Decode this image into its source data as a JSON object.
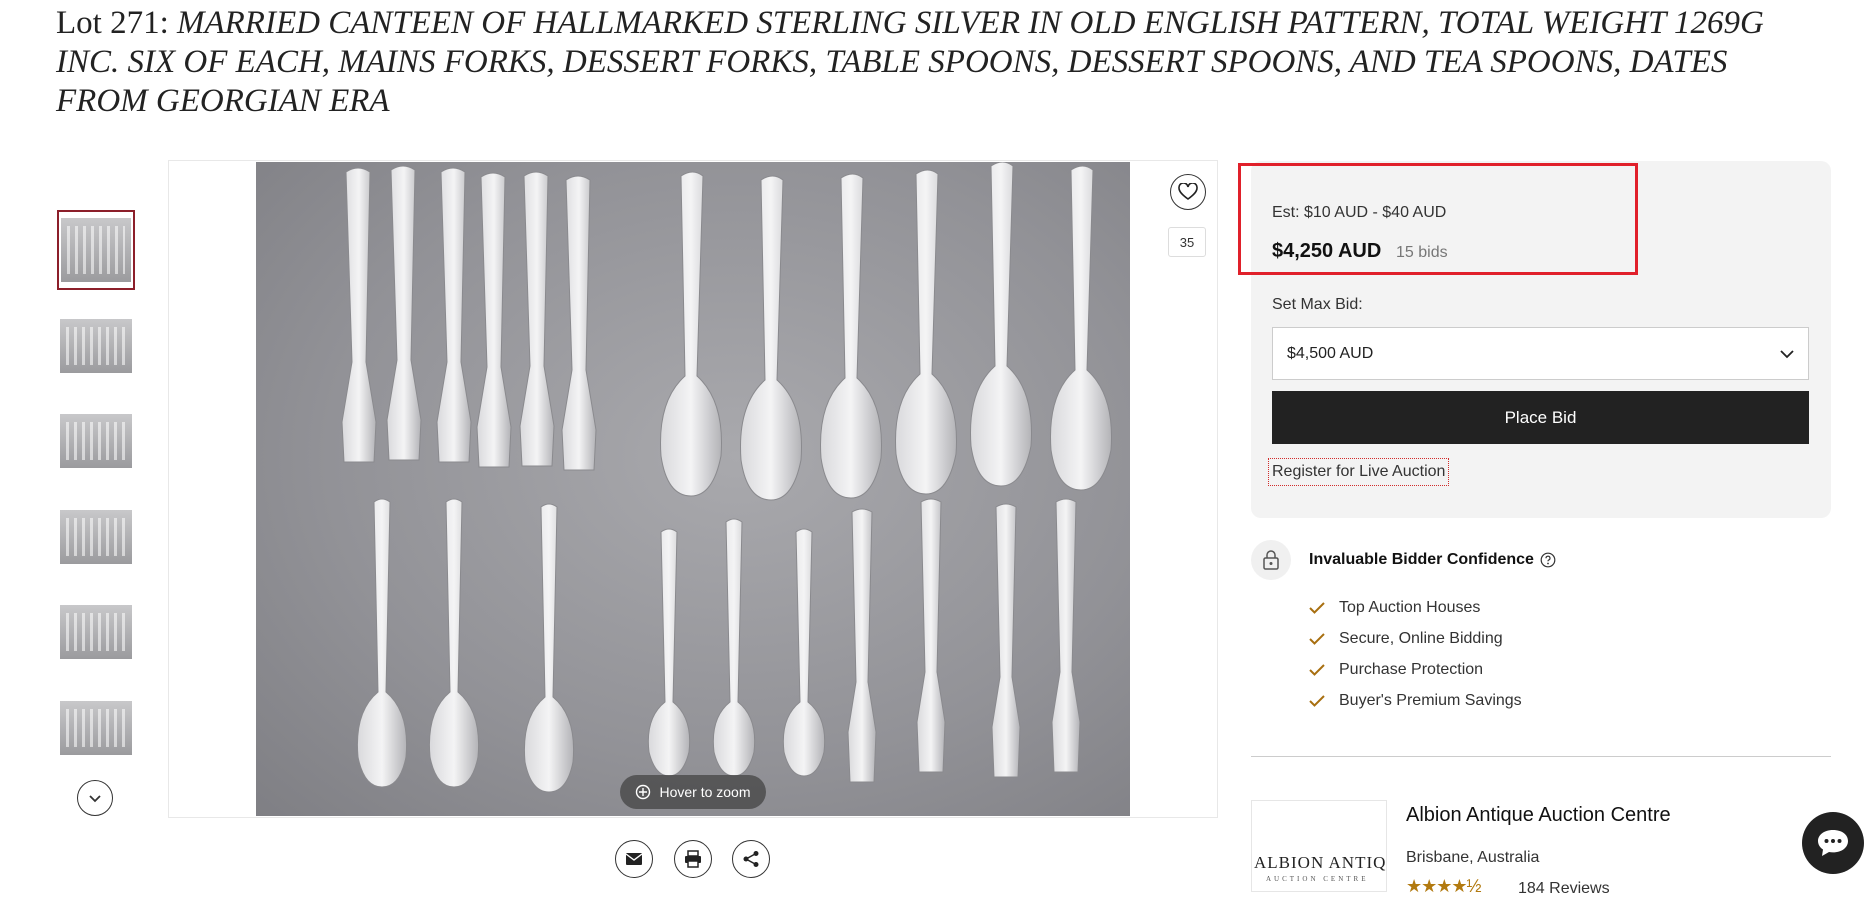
{
  "lot": {
    "prefix": "Lot 271:",
    "title": "MARRIED CANTEEN OF HALLMARKED STERLING SILVER IN OLD ENGLISH PATTERN, TOTAL WEIGHT 1269G INC. SIX OF EACH, MAINS FORKS, DESSERT FORKS, TABLE SPOONS, DESSERT SPOONS, AND TEA SPOONS, DATES FROM GEORGIAN ERA"
  },
  "gallery": {
    "thumbnail_count": 6,
    "active_index": 0,
    "favorite_count": "35",
    "zoom_label": "Hover to zoom",
    "icons": [
      "chevron-down-icon",
      "heart-icon",
      "envelope-icon",
      "printer-icon",
      "share-icon",
      "zoom-icon"
    ]
  },
  "bid_panel": {
    "estimate": "Est: $10 AUD - $40 AUD",
    "current_price": "$4,250 AUD",
    "bid_count": "15 bids",
    "max_bid_label": "Set Max Bid:",
    "max_bid_value": "$4,500 AUD",
    "place_bid_label": "Place Bid",
    "register_label": "Register for Live Auction",
    "highlight_color": "#e0202a"
  },
  "confidence": {
    "title": "Invaluable Bidder Confidence",
    "items": [
      "Top Auction Houses",
      "Secure, Online Bidding",
      "Purchase Protection",
      "Buyer's Premium Savings"
    ],
    "check_color": "#a86f10"
  },
  "auction_house": {
    "name": "Albion Antique Auction Centre",
    "location": "Brisbane, Australia",
    "logo_text": "ALBION ANTIQUE",
    "logo_subtext": "AUCTION CENTRE",
    "rating_stars": 4.5,
    "reviews": "184 Reviews"
  }
}
